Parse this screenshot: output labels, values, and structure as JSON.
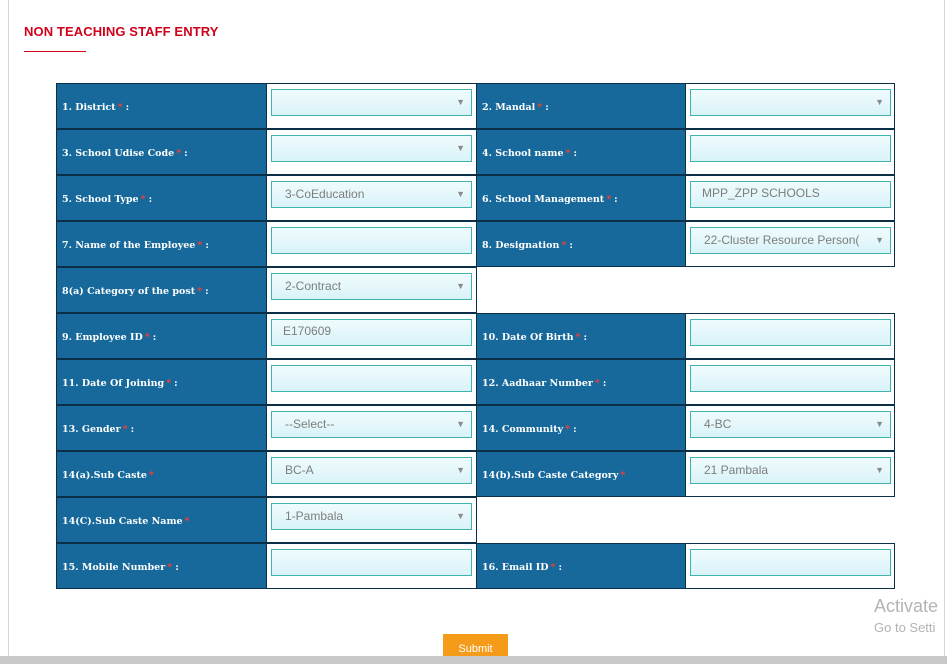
{
  "page": {
    "title": "NON TEACHING STAFF ENTRY"
  },
  "fields": {
    "district": {
      "label": "1. District",
      "value": ""
    },
    "mandal": {
      "label": "2. Mandal",
      "value": ""
    },
    "school_udise_code": {
      "label": "3. School Udise Code",
      "value": ""
    },
    "school_name": {
      "label": "4. School name",
      "value": ""
    },
    "school_type": {
      "label": "5. School Type",
      "value": "3-CoEducation"
    },
    "school_management": {
      "label": "6. School Management",
      "value": "MPP_ZPP SCHOOLS"
    },
    "employee_name": {
      "label": "7. Name of the Employee",
      "value": ""
    },
    "designation": {
      "label": "8. Designation",
      "value": "22-Cluster Resource Person("
    },
    "category_of_post": {
      "label": "8(a) Category of the post",
      "value": "2-Contract"
    },
    "employee_id": {
      "label": "9. Employee ID",
      "value": "E170609"
    },
    "date_of_birth": {
      "label": "10. Date Of Birth",
      "value": ""
    },
    "date_of_joining": {
      "label": "11. Date Of Joining",
      "value": ""
    },
    "aadhaar_number": {
      "label": "12. Aadhaar Number",
      "value": ""
    },
    "gender": {
      "label": "13. Gender",
      "value": "--Select--"
    },
    "community": {
      "label": "14. Community",
      "value": "4-BC"
    },
    "sub_caste": {
      "label": "14(a).Sub Caste",
      "value": "BC-A"
    },
    "sub_caste_category": {
      "label": "14(b).Sub Caste Category",
      "value": "21 Pambala"
    },
    "sub_caste_name": {
      "label": "14(C).Sub Caste Name",
      "value": "1-Pambala"
    },
    "mobile_number": {
      "label": "15. Mobile Number",
      "value": ""
    },
    "email_id": {
      "label": "16. Email ID",
      "value": ""
    }
  },
  "symbols": {
    "required": "*",
    "colon": ":",
    "dropdown_caret": "▼"
  },
  "submit": {
    "label": "Submit"
  },
  "watermark": {
    "line1": "Activate",
    "line2": "Go to Setti"
  },
  "colors": {
    "title": "#d0021b",
    "label_bg": "#16699a",
    "input_border": "#41b3ad",
    "submit_bg": "#f59b1a"
  }
}
